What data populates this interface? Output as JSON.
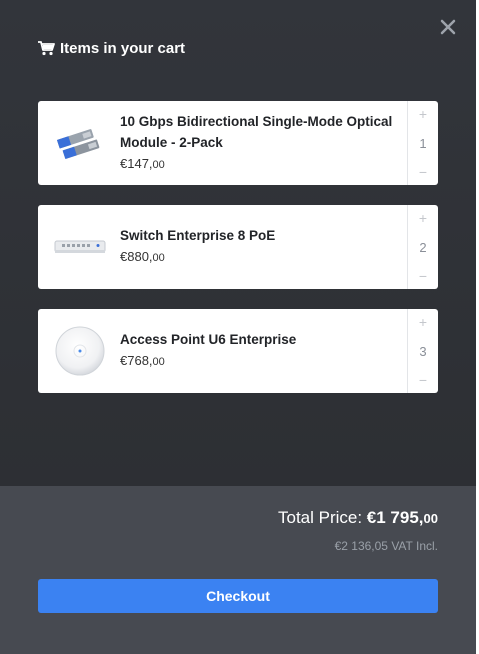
{
  "header": {
    "title": "Items in your cart",
    "icon": "cart-icon",
    "close_icon": "close-icon"
  },
  "items": [
    {
      "name": "10 Gbps Bidirectional Single-Mode Optical Module - 2-Pack",
      "price_main": "€147,",
      "price_cents": "00",
      "quantity": "1",
      "plus": "+",
      "minus": "−",
      "image": "optical-module-image"
    },
    {
      "name": "Switch Enterprise 8 PoE",
      "price_main": "€880,",
      "price_cents": "00",
      "quantity": "2",
      "plus": "+",
      "minus": "−",
      "image": "switch-image"
    },
    {
      "name": "Access Point U6 Enterprise",
      "price_main": "€768,",
      "price_cents": "00",
      "quantity": "3",
      "plus": "+",
      "minus": "−",
      "image": "access-point-image"
    }
  ],
  "footer": {
    "total_label": "Total Price: ",
    "total_main": "€1 795,",
    "total_cents": "00",
    "vat_text": "€2 136,05 VAT Incl.",
    "checkout_label": "Checkout"
  },
  "colors": {
    "panel_bg": "#2e3035",
    "footer_bg": "#474a51",
    "accent": "#3b82f2"
  }
}
